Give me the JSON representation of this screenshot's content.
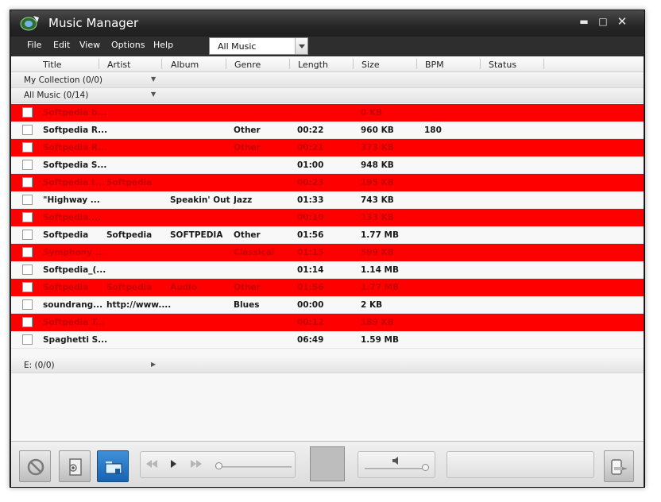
{
  "window": {
    "title": "Music Manager"
  },
  "menu": {
    "file": "File",
    "edit": "Edit",
    "view": "View",
    "options": "Options",
    "help": "Help"
  },
  "view_select": {
    "value": "All Music"
  },
  "columns": {
    "title": "Title",
    "artist": "Artist",
    "album": "Album",
    "genre": "Genre",
    "length": "Length",
    "size": "Size",
    "bpm": "BPM",
    "status": "Status"
  },
  "groups": {
    "collection": "My Collection (0/0)",
    "all_music": "All Music (0/14)",
    "drive": "E: (0/0)"
  },
  "tracks": [
    {
      "title": "Softpedia b...",
      "artist": "",
      "album": "",
      "genre": "",
      "length": "",
      "size": "0 KB",
      "bpm": "",
      "highlight": true
    },
    {
      "title": "Softpedia R...",
      "artist": "",
      "album": "",
      "genre": "Other",
      "length": "00:22",
      "size": "960 KB",
      "bpm": "180",
      "highlight": false
    },
    {
      "title": "Softpedia R...",
      "artist": "",
      "album": "",
      "genre": "Other",
      "length": "00:21",
      "size": "373 KB",
      "bpm": "",
      "highlight": true
    },
    {
      "title": "Softpedia S...",
      "artist": "",
      "album": "",
      "genre": "",
      "length": "01:00",
      "size": "948 KB",
      "bpm": "",
      "highlight": false
    },
    {
      "title": "Softpedia t...",
      "artist": "Softpedia",
      "album": "",
      "genre": "",
      "length": "00:23",
      "size": "195 KB",
      "bpm": "",
      "highlight": true
    },
    {
      "title": "\"Highway ...",
      "artist": "",
      "album": "Speakin' Out",
      "genre": "Jazz",
      "length": "01:33",
      "size": "743 KB",
      "bpm": "",
      "highlight": false
    },
    {
      "title": "Softpedia....",
      "artist": "",
      "album": "",
      "genre": "",
      "length": "00:10",
      "size": "133 KB",
      "bpm": "",
      "highlight": true
    },
    {
      "title": "Softpedia",
      "artist": "Softpedia",
      "album": "SOFTPEDIA",
      "genre": "Other",
      "length": "01:56",
      "size": "1.77 MB",
      "bpm": "",
      "highlight": false
    },
    {
      "title": "Symphony ...",
      "artist": "",
      "album": "",
      "genre": "Classical",
      "length": "01:15",
      "size": "599 KB",
      "bpm": "",
      "highlight": true
    },
    {
      "title": "Softpedia_(...",
      "artist": "",
      "album": "",
      "genre": "",
      "length": "01:14",
      "size": "1.14 MB",
      "bpm": "",
      "highlight": false
    },
    {
      "title": "Softpedia",
      "artist": "Softpedia",
      "album": "Audio",
      "genre": "Other",
      "length": "01:56",
      "size": "1.77 MB",
      "bpm": "",
      "highlight": true
    },
    {
      "title": "soundrang...",
      "artist": "http://www....",
      "album": "",
      "genre": "Blues",
      "length": "00:00",
      "size": "2 KB",
      "bpm": "",
      "highlight": false
    },
    {
      "title": "Softpedia T...",
      "artist": "",
      "album": "",
      "genre": "",
      "length": "00:12",
      "size": "189 KB",
      "bpm": "",
      "highlight": true
    },
    {
      "title": "Spaghetti S...",
      "artist": "",
      "album": "",
      "genre": "",
      "length": "06:49",
      "size": "1.59 MB",
      "bpm": "",
      "highlight": false
    }
  ],
  "colors": {
    "highlight_row": "#ff0000",
    "highlight_text": "#c80000",
    "titlebar": "#262626"
  },
  "icons": {
    "stop": "block-icon",
    "import": "add-to-device-icon",
    "library": "folder-icon",
    "prev": "rewind-icon",
    "play": "play-icon",
    "next": "fast-forward-icon",
    "volume": "speaker-icon",
    "eject": "disconnect-device-icon"
  }
}
